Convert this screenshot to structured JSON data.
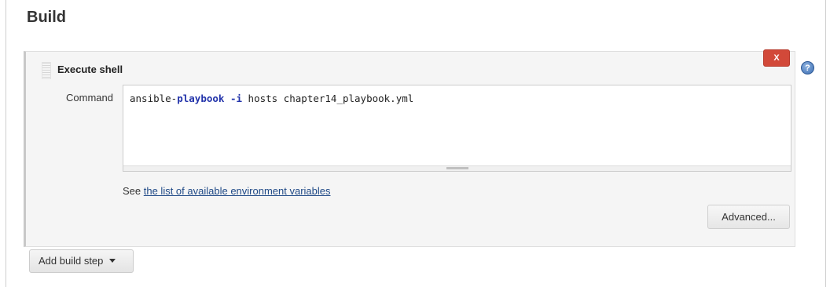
{
  "section": {
    "title": "Build"
  },
  "build_step": {
    "title": "Execute shell",
    "delete_label": "X",
    "command_label": "Command",
    "command": {
      "part1": "ansible-",
      "part2": "playbook",
      "part3": " ",
      "part4": "-i",
      "part5": " hosts chapter14_playbook.yml"
    },
    "see_prefix": "See ",
    "env_link": "the list of available environment variables",
    "advanced_label": "Advanced..."
  },
  "help": {
    "icon": "help-icon",
    "glyph": "?"
  },
  "add_step": {
    "label": "Add build step",
    "icon": "caret-down-icon"
  },
  "colors": {
    "delete_red": "#d24939",
    "link_blue": "#204a87",
    "keyword_blue": "#2233aa"
  }
}
